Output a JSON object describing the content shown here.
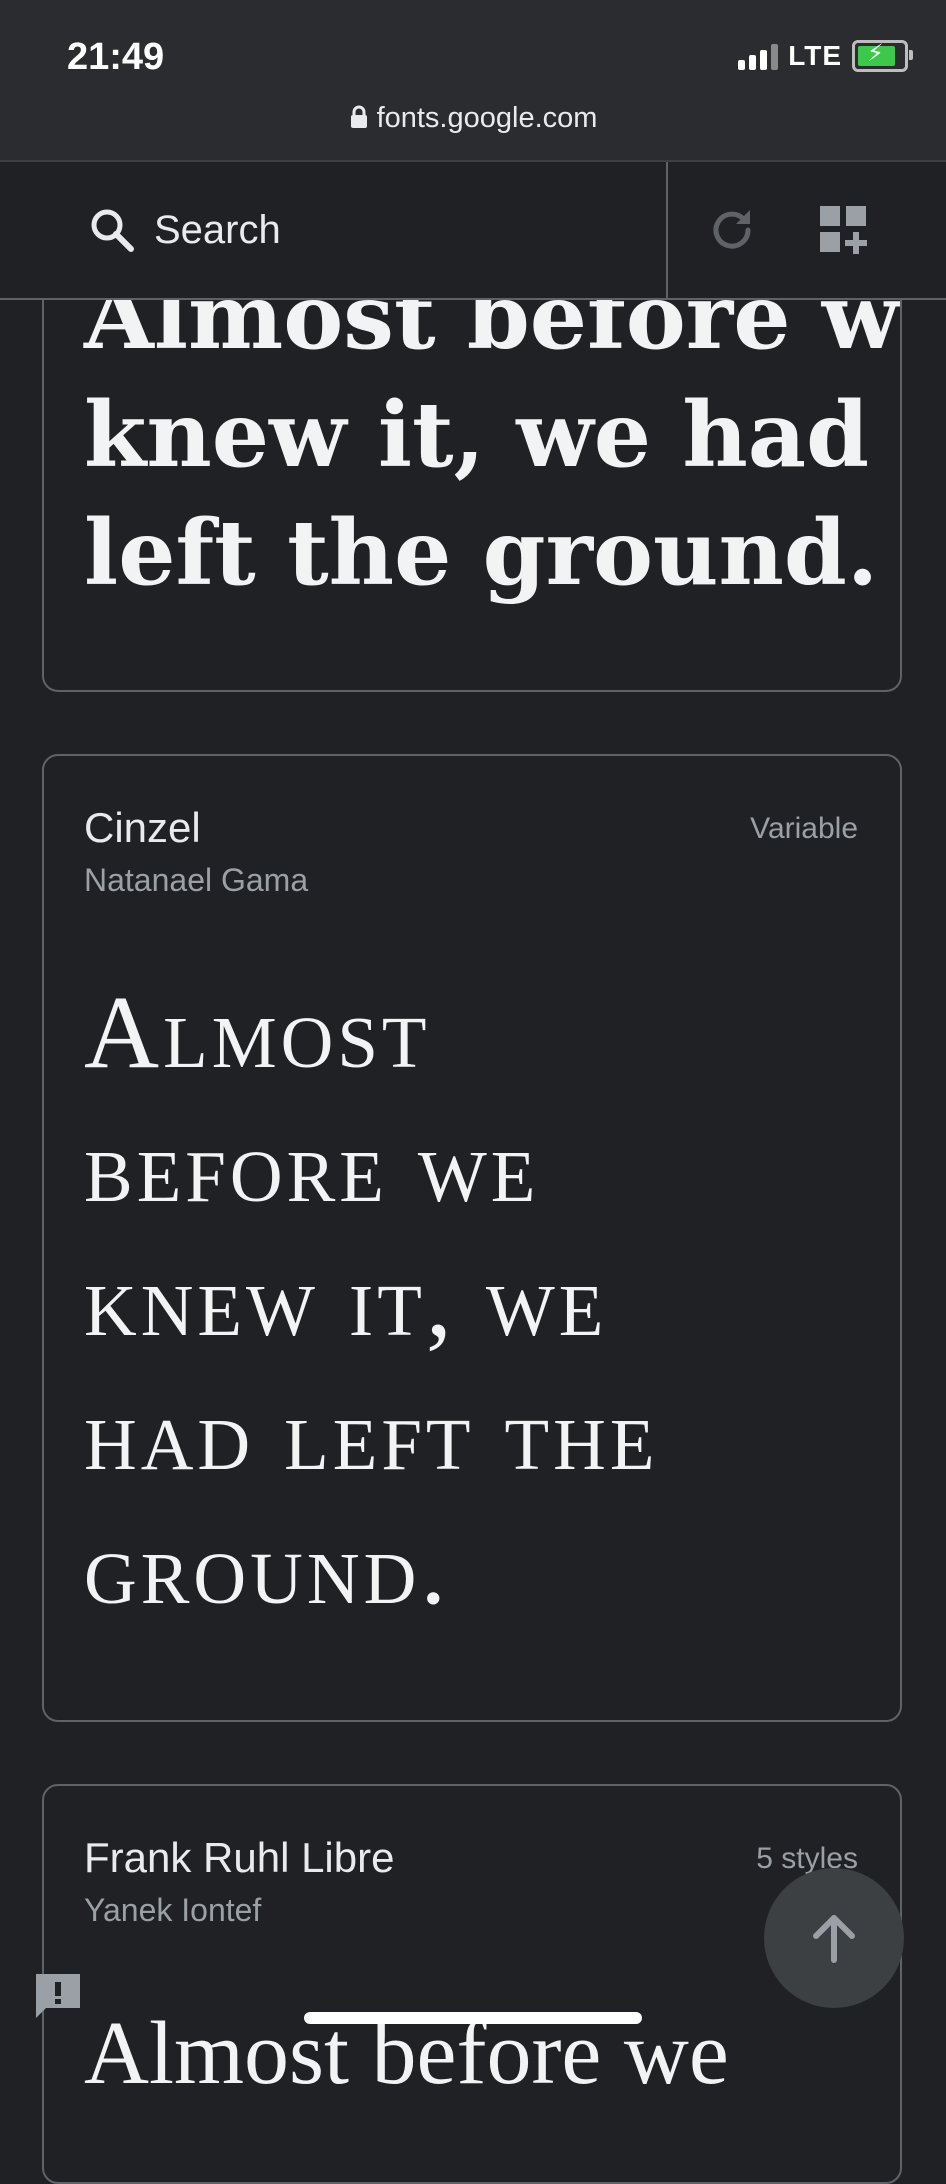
{
  "status_bar": {
    "time": "21:49",
    "network": "LTE"
  },
  "browser": {
    "url": "fonts.google.com"
  },
  "toolbar": {
    "search_label": "Search"
  },
  "cards": [
    {
      "sample_lines": [
        "Almost before we",
        "knew it, we had",
        "left the ground."
      ]
    },
    {
      "name": "Cinzel",
      "designer": "Natanael Gama",
      "styles": "Variable",
      "sample_lines": [
        "Almost",
        "before we",
        "knew it, we",
        "had left the",
        "ground."
      ]
    },
    {
      "name": "Frank Ruhl Libre",
      "designer": "Yanek Iontef",
      "styles": "5 styles",
      "sample_text": "Almost before we"
    }
  ],
  "colors": {
    "background": "#202124",
    "card_border": "#5f6368",
    "text_primary": "#e8eaed",
    "text_secondary": "#9aa0a6",
    "battery_green": "#3ec84b"
  },
  "icons": {
    "search": "search-icon",
    "refresh": "refresh-icon",
    "add_collection": "add-collection-icon",
    "scroll_top": "arrow-up-icon",
    "feedback": "feedback-icon"
  }
}
